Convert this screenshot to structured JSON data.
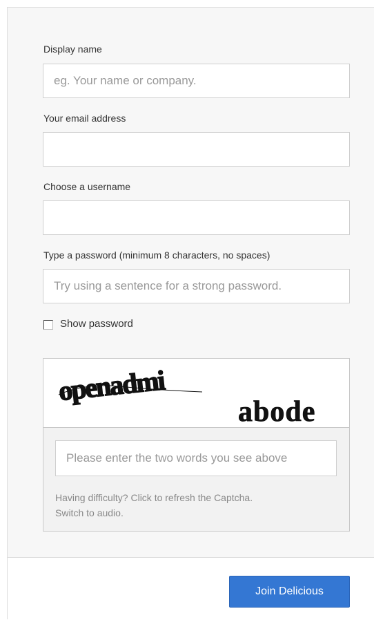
{
  "form": {
    "display_name": {
      "label": "Display name",
      "placeholder": "eg. Your name or company.",
      "value": ""
    },
    "email": {
      "label": "Your email address",
      "placeholder": "",
      "value": ""
    },
    "username": {
      "label": "Choose a username",
      "placeholder": "",
      "value": ""
    },
    "password": {
      "label": "Type a password (minimum 8 characters, no spaces)",
      "placeholder": "Try using a sentence for a strong password.",
      "value": ""
    },
    "show_password": {
      "label": "Show password",
      "checked": false
    }
  },
  "captcha": {
    "word1": "openadmi",
    "word2": "abode",
    "input_placeholder": "Please enter the two words you see above",
    "help_text": "Having difficulty?",
    "refresh_link": "Click to refresh the Captcha.",
    "audio_link": "Switch to audio."
  },
  "footer": {
    "join_label": "Join Delicious",
    "join_color": "#3477d3"
  }
}
